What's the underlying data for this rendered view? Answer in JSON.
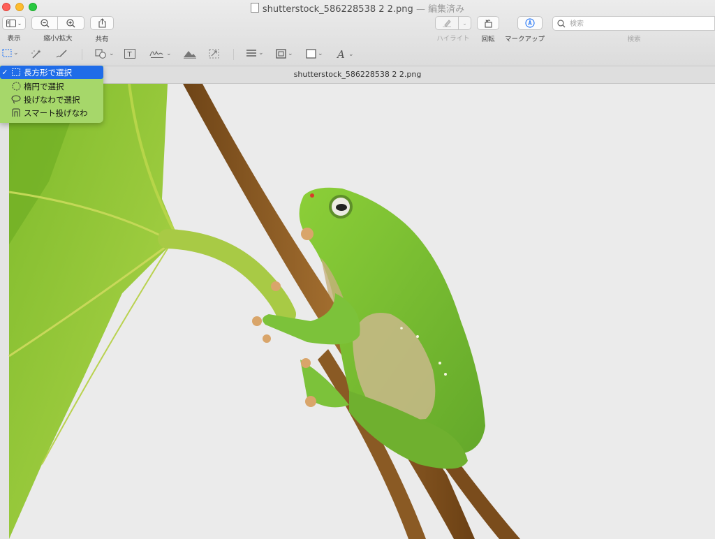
{
  "window": {
    "title": "shutterstock_586228538 2 2.png",
    "title_suffix": "— 編集済み"
  },
  "toolbar": {
    "view_label": "表示",
    "zoom_label": "縮小/拡大",
    "share_label": "共有",
    "highlight_label": "ハイライト",
    "rotate_label": "回転",
    "markup_label": "マークアップ",
    "search_label": "検索",
    "search_placeholder": "検索"
  },
  "markup_tools": {
    "icons": [
      "rect-selection-icon",
      "instant-alpha-icon",
      "sketch-icon",
      "shapes-icon",
      "text-icon",
      "sign-icon",
      "adjust-color-icon",
      "adjust-size-icon",
      "shape-style-icon",
      "border-color-icon",
      "fill-color-icon",
      "text-style-icon"
    ]
  },
  "tab": {
    "title": "shutterstock_586228538 2 2.png"
  },
  "selection_menu": {
    "items": [
      {
        "label": "長方形で選択",
        "selected": true,
        "icon": "rect-select-icon"
      },
      {
        "label": "楕円で選択",
        "selected": false,
        "icon": "ellipse-select-icon"
      },
      {
        "label": "投げなわで選択",
        "selected": false,
        "icon": "lasso-select-icon"
      },
      {
        "label": "スマート投げなわ",
        "selected": false,
        "icon": "smart-lasso-icon"
      }
    ],
    "check_mark": "✓"
  },
  "colors": {
    "menu_bg": "#a6d76a",
    "menu_selected": "#1f6ce8",
    "markup_accent": "#2f7cf6",
    "frog_green": "#7cc23a",
    "leaf_green": "#8fc43a",
    "stem_brown": "#8a5a24"
  }
}
